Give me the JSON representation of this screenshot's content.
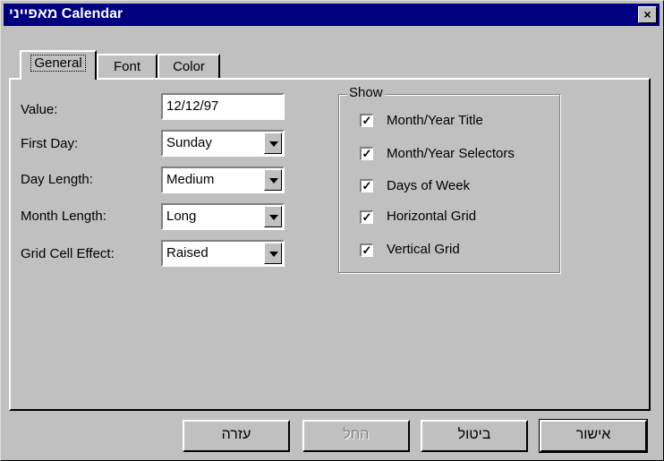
{
  "window": {
    "title": "מאפייני Calendar",
    "close_glyph": "×"
  },
  "tabs": [
    {
      "label": "General",
      "active": true
    },
    {
      "label": "Font",
      "active": false
    },
    {
      "label": "Color",
      "active": false
    }
  ],
  "fields": {
    "value": {
      "label": "Value:",
      "text": "12/12/97"
    },
    "first_day": {
      "label": "First Day:",
      "selected": "Sunday"
    },
    "day_length": {
      "label": "Day Length:",
      "selected": "Medium"
    },
    "month_length": {
      "label": "Month Length:",
      "selected": "Long"
    },
    "grid_cell_effect": {
      "label": "Grid Cell Effect:",
      "selected": "Raised"
    }
  },
  "show": {
    "title": "Show",
    "items": [
      {
        "label": "Month/Year Title",
        "checked": true
      },
      {
        "label": "Month/Year Selectors",
        "checked": true
      },
      {
        "label": "Days of Week",
        "checked": true
      },
      {
        "label": "Horizontal Grid",
        "checked": true
      },
      {
        "label": "Vertical Grid",
        "checked": true
      }
    ],
    "check_glyph": "✓"
  },
  "buttons": {
    "help": "עזרה",
    "apply": "החל",
    "cancel": "ביטול",
    "ok": "אישור"
  }
}
